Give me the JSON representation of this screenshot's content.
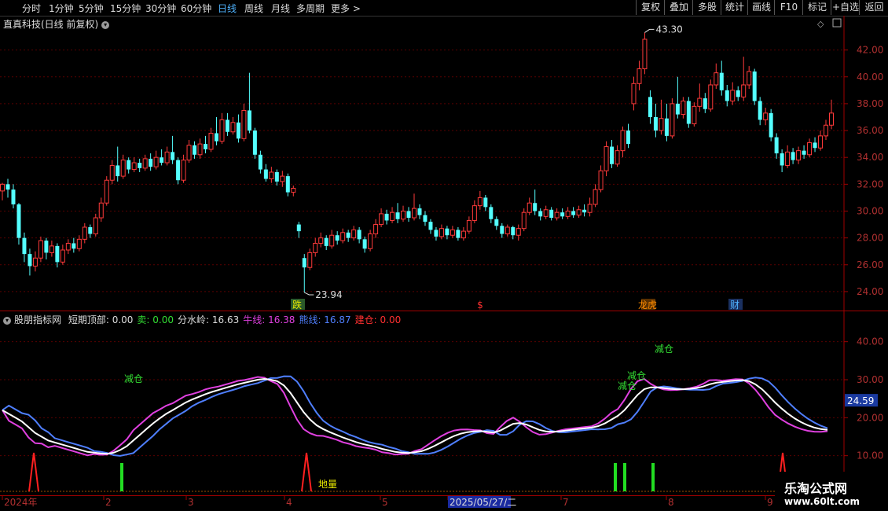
{
  "toolbar": {
    "periods": [
      "分时",
      "1分钟",
      "5分钟",
      "15分钟",
      "30分钟",
      "60分钟",
      "日线",
      "周线",
      "月线",
      "多周期",
      "更多"
    ],
    "active": "日线",
    "right_buttons": [
      "复权",
      "叠加",
      "多股",
      "统计",
      "画线",
      "F10",
      "标记",
      "+自选",
      "返回"
    ]
  },
  "main_chart": {
    "title": "直真科技(日线 前复权)",
    "y_ticks": [
      "42.00",
      "40.00",
      "38.00",
      "36.00",
      "34.00",
      "32.00",
      "30.00",
      "28.00",
      "26.00",
      "24.00"
    ],
    "high_label": "43.30",
    "low_label": "23.94",
    "markers": [
      {
        "text": "跌",
        "color": "#e8e800",
        "bg": "#2a5a2a"
      },
      {
        "text": "$",
        "color": "#ff3030",
        "bg": ""
      },
      {
        "text": "龙虎",
        "color": "#ff8c00",
        "bg": "#5a3000"
      },
      {
        "text": "财",
        "color": "#4fb3ff",
        "bg": "#1a3060"
      }
    ]
  },
  "indicator": {
    "name": "股朋指标网",
    "items": [
      {
        "label": "短期顶部:",
        "value": "0.00",
        "color": "#dddddd"
      },
      {
        "label": "卖:",
        "value": "0.00",
        "color": "#33dd33"
      },
      {
        "label": "分水岭:",
        "value": "16.63",
        "color": "#dddddd"
      },
      {
        "label": "牛线:",
        "value": "16.38",
        "color": "#e040e0"
      },
      {
        "label": "熊线:",
        "value": "16.87",
        "color": "#4f7fff"
      },
      {
        "label": "建仓:",
        "value": "0.00",
        "color": "#ff3030"
      }
    ],
    "y_ticks": [
      "40.00",
      "30.00",
      "20.00",
      "10.00"
    ],
    "current_value": "24.59",
    "annotations": [
      "减仓",
      "减仓",
      "减仓",
      "减仓",
      "地量"
    ]
  },
  "time_axis": {
    "labels": [
      "2024年",
      "2",
      "3",
      "4",
      "5",
      "2025/05/27/二",
      "7",
      "8",
      "9"
    ]
  },
  "watermark": {
    "line1": "乐淘公式网",
    "line2": "www.60lt.com"
  },
  "chart_data": {
    "type": "candlestick",
    "price_range": [
      23,
      43.5
    ],
    "candles": [
      [
        31.5,
        32.0,
        30.8,
        32.1
      ],
      [
        32.0,
        31.6,
        31.0,
        32.4
      ],
      [
        31.6,
        30.5,
        30.2,
        32.0
      ],
      [
        30.5,
        28.0,
        27.5,
        30.6
      ],
      [
        28.0,
        26.8,
        26.2,
        28.4
      ],
      [
        26.8,
        25.9,
        25.2,
        27.2
      ],
      [
        25.9,
        26.5,
        25.5,
        27.0
      ],
      [
        26.5,
        27.8,
        26.2,
        28.1
      ],
      [
        27.8,
        26.9,
        26.4,
        28.0
      ],
      [
        26.9,
        27.4,
        26.6,
        27.8
      ],
      [
        27.4,
        26.2,
        25.8,
        27.6
      ],
      [
        26.2,
        27.1,
        26.0,
        27.5
      ],
      [
        27.1,
        27.6,
        26.8,
        27.9
      ],
      [
        27.6,
        27.2,
        26.9,
        28.0
      ],
      [
        27.2,
        27.9,
        27.0,
        28.2
      ],
      [
        27.9,
        28.8,
        27.6,
        29.1
      ],
      [
        28.8,
        28.3,
        28.0,
        29.0
      ],
      [
        28.3,
        29.5,
        28.1,
        29.8
      ],
      [
        29.5,
        30.6,
        29.2,
        31.0
      ],
      [
        30.6,
        32.3,
        30.4,
        32.6
      ],
      [
        32.3,
        33.4,
        32.0,
        33.8
      ],
      [
        33.4,
        32.6,
        32.2,
        34.8
      ],
      [
        32.6,
        33.8,
        32.4,
        34.2
      ],
      [
        33.8,
        33.1,
        32.8,
        34.0
      ],
      [
        33.1,
        33.6,
        32.9,
        34.0
      ],
      [
        33.6,
        33.2,
        32.9,
        33.9
      ],
      [
        33.2,
        33.9,
        33.0,
        34.2
      ],
      [
        33.9,
        33.3,
        33.0,
        34.3
      ],
      [
        33.3,
        34.0,
        33.1,
        34.5
      ],
      [
        34.0,
        33.6,
        33.4,
        34.6
      ],
      [
        33.6,
        34.4,
        33.4,
        34.8
      ],
      [
        34.4,
        33.8,
        33.5,
        35.6
      ],
      [
        33.8,
        32.3,
        32.0,
        34.0
      ],
      [
        32.3,
        33.8,
        32.1,
        34.2
      ],
      [
        33.8,
        34.9,
        33.6,
        35.3
      ],
      [
        34.9,
        34.2,
        33.9,
        35.2
      ],
      [
        34.2,
        35.0,
        33.9,
        35.4
      ],
      [
        35.0,
        34.6,
        34.3,
        35.6
      ],
      [
        34.6,
        35.8,
        34.4,
        36.2
      ],
      [
        35.8,
        35.2,
        34.9,
        37.0
      ],
      [
        35.2,
        36.8,
        35.0,
        37.3
      ],
      [
        36.8,
        35.9,
        35.6,
        37.3
      ],
      [
        35.9,
        36.6,
        35.7,
        37.0
      ],
      [
        36.6,
        35.4,
        35.1,
        37.2
      ],
      [
        35.4,
        37.5,
        35.2,
        38.0
      ],
      [
        37.5,
        36.0,
        35.8,
        40.3
      ],
      [
        36.0,
        34.2,
        33.9,
        36.2
      ],
      [
        34.2,
        33.1,
        32.8,
        34.5
      ],
      [
        33.1,
        32.4,
        32.2,
        33.5
      ],
      [
        32.4,
        32.9,
        32.1,
        33.3
      ],
      [
        32.9,
        32.2,
        31.9,
        33.1
      ],
      [
        32.2,
        32.6,
        31.8,
        33.0
      ],
      [
        32.6,
        31.4,
        31.1,
        32.8
      ],
      [
        31.4,
        31.7,
        31.1,
        31.9
      ],
      [
        29.0,
        28.5,
        28.0,
        29.2
      ],
      [
        26.5,
        25.8,
        23.94,
        26.8
      ],
      [
        25.8,
        26.9,
        25.6,
        27.2
      ],
      [
        26.9,
        27.6,
        26.6,
        28.0
      ],
      [
        27.6,
        28.0,
        27.3,
        28.4
      ],
      [
        28.0,
        27.4,
        27.1,
        28.2
      ],
      [
        27.4,
        28.2,
        27.2,
        28.6
      ],
      [
        28.2,
        27.8,
        27.5,
        28.5
      ],
      [
        27.8,
        28.4,
        27.6,
        28.7
      ],
      [
        28.4,
        28.0,
        27.7,
        28.6
      ],
      [
        28.0,
        28.6,
        27.8,
        28.9
      ],
      [
        28.6,
        27.9,
        27.6,
        28.8
      ],
      [
        27.9,
        27.2,
        26.9,
        28.1
      ],
      [
        27.2,
        28.3,
        27.0,
        28.6
      ],
      [
        28.3,
        29.0,
        28.0,
        29.4
      ],
      [
        29.0,
        29.8,
        28.8,
        30.2
      ],
      [
        29.8,
        29.3,
        29.0,
        30.1
      ],
      [
        29.3,
        29.9,
        29.1,
        30.3
      ],
      [
        29.9,
        29.4,
        29.1,
        30.6
      ],
      [
        29.4,
        30.0,
        29.2,
        30.4
      ],
      [
        30.0,
        29.5,
        29.2,
        30.3
      ],
      [
        29.5,
        30.2,
        29.3,
        31.3
      ],
      [
        30.2,
        29.7,
        29.4,
        30.5
      ],
      [
        29.7,
        29.2,
        28.9,
        30.0
      ],
      [
        29.2,
        28.6,
        28.3,
        29.4
      ],
      [
        28.6,
        28.1,
        27.8,
        28.8
      ],
      [
        28.1,
        28.7,
        27.9,
        29.0
      ],
      [
        28.7,
        28.2,
        27.9,
        28.9
      ],
      [
        28.2,
        28.6,
        28.0,
        28.9
      ],
      [
        28.6,
        28.0,
        27.8,
        28.8
      ],
      [
        28.0,
        28.5,
        27.8,
        28.8
      ],
      [
        28.5,
        29.3,
        28.3,
        29.6
      ],
      [
        29.3,
        30.4,
        29.1,
        30.8
      ],
      [
        30.4,
        31.0,
        30.1,
        31.5
      ],
      [
        31.0,
        30.3,
        30.0,
        31.2
      ],
      [
        30.3,
        29.4,
        29.1,
        30.5
      ],
      [
        29.4,
        28.9,
        28.6,
        29.6
      ],
      [
        28.9,
        28.3,
        28.0,
        29.1
      ],
      [
        28.3,
        28.8,
        28.1,
        29.0
      ],
      [
        28.8,
        28.2,
        27.9,
        28.9
      ],
      [
        28.2,
        28.7,
        27.8,
        29.0
      ],
      [
        28.7,
        29.9,
        28.5,
        30.2
      ],
      [
        29.9,
        30.6,
        29.7,
        31.0
      ],
      [
        30.6,
        30.0,
        29.7,
        31.6
      ],
      [
        30.0,
        29.6,
        29.3,
        30.2
      ],
      [
        29.6,
        30.1,
        29.4,
        30.4
      ],
      [
        30.1,
        29.5,
        29.3,
        30.3
      ],
      [
        29.5,
        29.9,
        29.3,
        30.2
      ],
      [
        29.9,
        29.6,
        29.4,
        30.2
      ],
      [
        29.6,
        30.0,
        29.4,
        30.3
      ],
      [
        30.0,
        29.7,
        29.5,
        30.3
      ],
      [
        29.7,
        30.1,
        29.5,
        30.4
      ],
      [
        30.1,
        29.9,
        29.6,
        30.5
      ],
      [
        29.9,
        30.5,
        29.6,
        31.0
      ],
      [
        30.5,
        31.6,
        30.3,
        32.0
      ],
      [
        31.6,
        33.0,
        31.4,
        33.4
      ],
      [
        33.0,
        34.8,
        32.6,
        35.2
      ],
      [
        34.8,
        33.5,
        33.2,
        35.3
      ],
      [
        33.5,
        34.5,
        33.3,
        34.9
      ],
      [
        34.5,
        36.0,
        34.0,
        36.3
      ],
      [
        36.0,
        35.0,
        34.7,
        36.5
      ],
      [
        38.0,
        39.5,
        37.5,
        40.0
      ],
      [
        39.5,
        40.6,
        39.0,
        41.2
      ],
      [
        40.6,
        42.8,
        40.2,
        43.3
      ],
      [
        38.5,
        37.0,
        36.5,
        39.0
      ],
      [
        37.0,
        36.0,
        35.5,
        38.0
      ],
      [
        36.0,
        36.9,
        35.7,
        38.3
      ],
      [
        36.9,
        35.6,
        35.2,
        38.0
      ],
      [
        35.6,
        38.0,
        35.4,
        38.4
      ],
      [
        38.0,
        37.2,
        36.9,
        40.0
      ],
      [
        37.2,
        38.2,
        36.9,
        38.5
      ],
      [
        38.2,
        36.5,
        36.2,
        38.5
      ],
      [
        36.5,
        37.8,
        36.3,
        38.1
      ],
      [
        37.8,
        38.4,
        37.4,
        39.5
      ],
      [
        38.4,
        37.6,
        37.3,
        38.8
      ],
      [
        37.6,
        39.4,
        37.4,
        39.8
      ],
      [
        39.4,
        40.3,
        39.1,
        41.0
      ],
      [
        40.3,
        39.0,
        38.6,
        41.2
      ],
      [
        39.0,
        38.2,
        37.8,
        39.4
      ],
      [
        38.2,
        39.0,
        37.9,
        39.6
      ],
      [
        39.0,
        38.5,
        38.2,
        39.3
      ],
      [
        38.5,
        39.4,
        38.2,
        41.5
      ],
      [
        39.4,
        40.4,
        39.1,
        40.8
      ],
      [
        40.4,
        38.2,
        37.9,
        40.6
      ],
      [
        38.2,
        36.8,
        36.4,
        38.5
      ],
      [
        36.8,
        37.3,
        36.4,
        37.7
      ],
      [
        37.3,
        35.5,
        35.2,
        37.6
      ],
      [
        35.5,
        34.3,
        33.9,
        35.8
      ],
      [
        34.3,
        33.4,
        32.9,
        34.6
      ],
      [
        33.4,
        34.4,
        33.2,
        34.9
      ],
      [
        34.4,
        33.8,
        33.5,
        34.7
      ],
      [
        33.8,
        34.5,
        33.5,
        34.8
      ],
      [
        34.5,
        34.2,
        33.9,
        34.9
      ],
      [
        34.2,
        35.1,
        34.0,
        35.4
      ],
      [
        35.1,
        34.7,
        34.4,
        35.5
      ],
      [
        34.7,
        35.6,
        34.5,
        36.0
      ],
      [
        35.6,
        36.4,
        35.3,
        36.8
      ],
      [
        36.4,
        37.3,
        36.1,
        38.3
      ]
    ],
    "indicator_series": {
      "white": [
        22,
        21,
        20,
        19,
        17.5,
        16,
        15,
        14,
        13.5,
        13,
        12.5,
        12,
        11.5,
        11,
        10.8,
        10.6,
        10.5,
        10.8,
        11.5,
        12.5,
        14,
        15.5,
        17,
        18.5,
        19.8,
        21,
        22,
        23,
        24,
        24.8,
        25.5,
        26.2,
        26.8,
        27.3,
        27.8,
        28.3,
        28.8,
        29.2,
        29.6,
        30,
        30.2,
        30,
        29.6,
        28.5,
        26.5,
        24,
        21.5,
        19.5,
        18,
        17,
        16.2,
        15.5,
        14.8,
        14.2,
        13.6,
        13.1,
        12.7,
        12.3,
        11.8,
        11.4,
        11,
        10.8,
        10.7,
        10.9,
        11.2,
        11.8,
        12.6,
        13.5,
        14.4,
        15.2,
        15.8,
        16.2,
        16.4,
        16.5,
        16.3,
        16.1,
        16.6,
        17.5,
        18.4,
        18.6,
        18.2,
        17.5,
        16.8,
        16.4,
        16.3,
        16.4,
        16.6,
        16.8,
        17,
        17.2,
        17.4,
        17.8,
        18.5,
        19.5,
        20.5,
        22,
        24,
        26,
        27.5,
        28,
        28,
        27.8,
        27.6,
        27.5,
        27.5,
        27.6,
        27.8,
        28.2,
        28.8,
        29.2,
        29.4,
        29.6,
        29.8,
        29.9,
        29.6,
        28.8,
        27.5,
        25.8,
        24,
        22.4,
        21,
        19.8,
        18.8,
        18,
        17.4,
        17,
        16.8
      ]
    },
    "signals": {
      "red_spikes_x": [
        43,
        390,
        996
      ],
      "green_bars_x": [
        155,
        783,
        795,
        831
      ]
    }
  }
}
